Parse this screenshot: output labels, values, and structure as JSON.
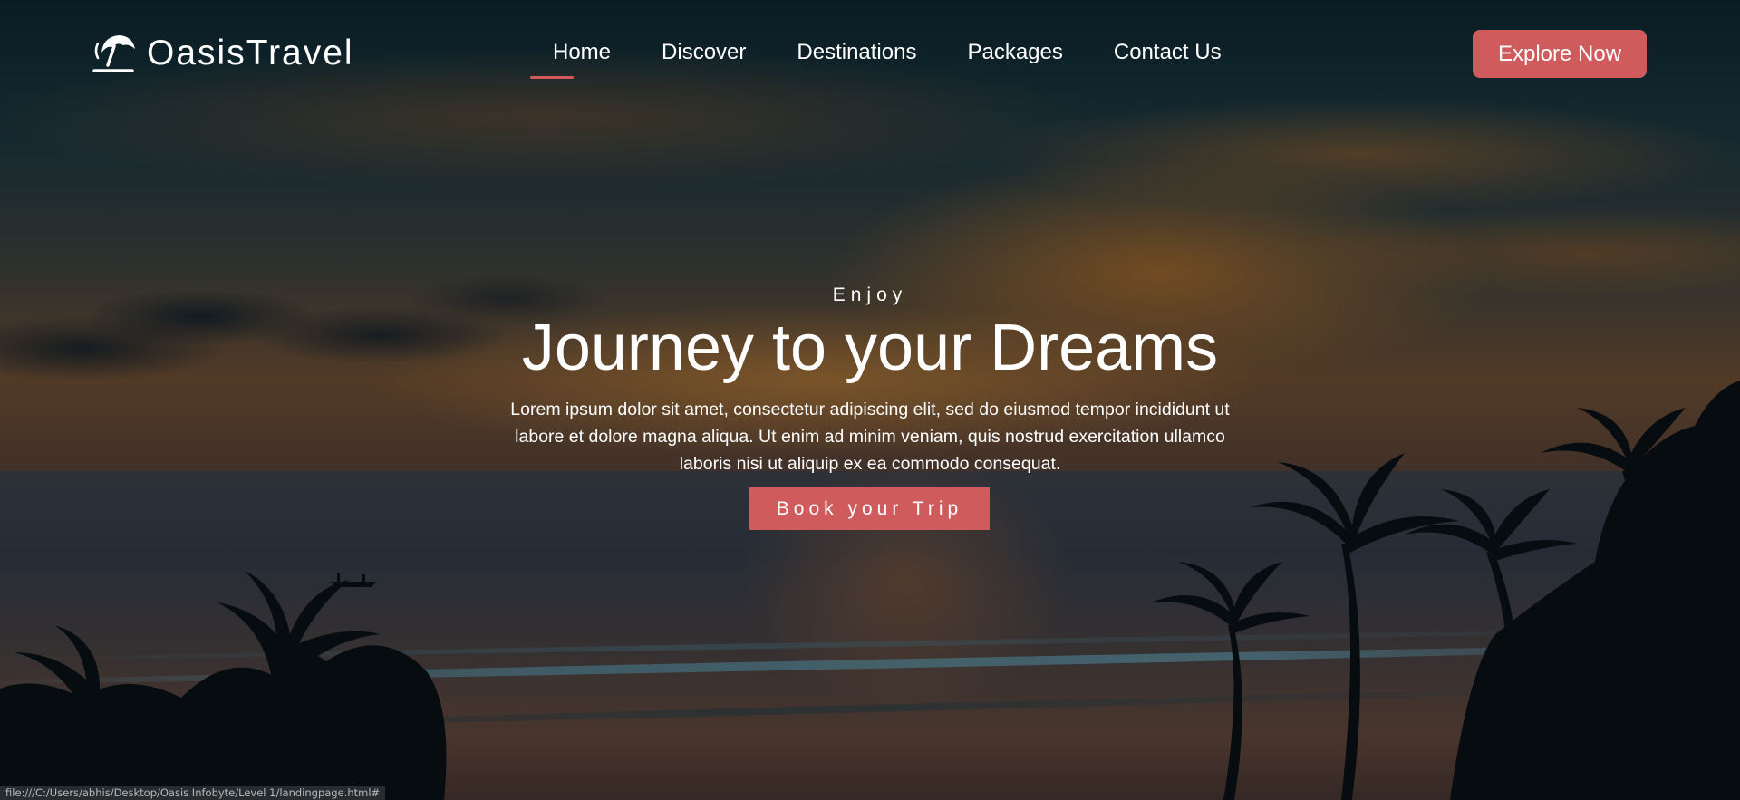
{
  "brand": {
    "name": "OasisTravel",
    "icon": "beach-umbrella-icon"
  },
  "nav": {
    "items": [
      {
        "label": "Home",
        "active": true
      },
      {
        "label": "Discover",
        "active": false
      },
      {
        "label": "Destinations",
        "active": false
      },
      {
        "label": "Packages",
        "active": false
      },
      {
        "label": "Contact Us",
        "active": false
      }
    ],
    "cta_label": "Explore Now"
  },
  "hero": {
    "eyebrow": "Enjoy",
    "title": "Journey to your Dreams",
    "description": "Lorem ipsum dolor sit amet, consectetur adipiscing elit, sed do eiusmod tempor incididunt ut labore et dolore magna aliqua. Ut enim ad minim veniam, quis nostrud exercitation ullamco laboris nisi ut aliquip ex ea commodo consequat.",
    "button_label": "Book your Trip"
  },
  "status_bar": {
    "url": "file:///C:/Users/abhis/Desktop/Oasis Infobyte/Level 1/landingpage.html#"
  },
  "colors": {
    "accent": "#cf5b5d",
    "text": "#ffffff"
  }
}
